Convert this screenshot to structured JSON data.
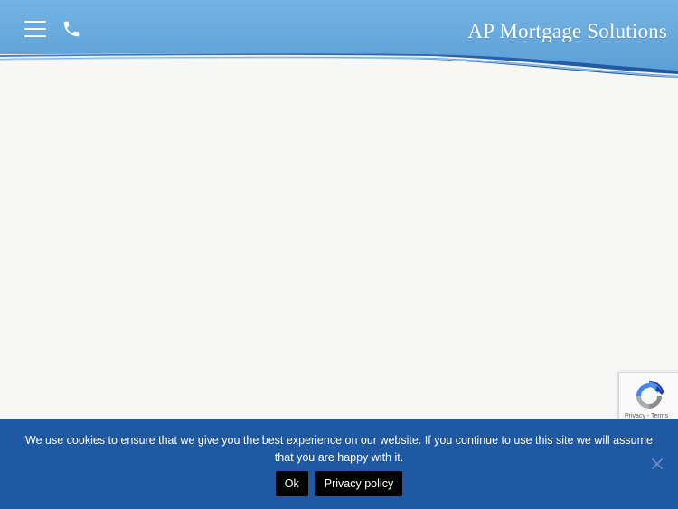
{
  "header": {
    "brand": "AP Mortgage Solutions",
    "menu_icon": "hamburger-menu-icon",
    "phone_icon": "phone-icon",
    "colors": {
      "top_blue": "#6aaede",
      "wave_dark": "#2a66b0",
      "wave_light": "#ffffff"
    }
  },
  "recaptcha": {
    "links": "Privacy - Terms",
    "icon": "recaptcha-icon"
  },
  "cookie_notice": {
    "message": "We use cookies to ensure that we give you the best experience on our website. If you continue to use this site we will assume that you are happy with it.",
    "ok_label": "Ok",
    "privacy_label": "Privacy policy",
    "close_icon": "close-icon",
    "background": "#1f58a3"
  }
}
